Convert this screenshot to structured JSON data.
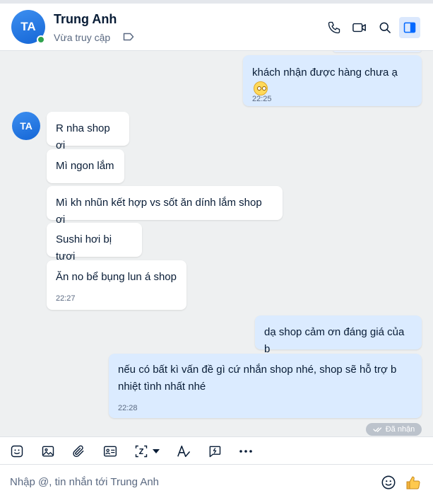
{
  "header": {
    "avatar_initials": "TA",
    "contact_name": "Trung Anh",
    "status": "Vừa truy cập",
    "icons": [
      "tag-icon",
      "phone-icon",
      "video-call-icon",
      "search-icon",
      "sidebar-toggle-icon"
    ]
  },
  "messages": [
    {
      "direction": "out",
      "text": "khách nhận được hàng chưa ạ",
      "emoji": "smiling-face-emoji",
      "time": "22:25"
    },
    {
      "direction": "in",
      "avatar_initials": "TA",
      "text": "R nha shop ơi"
    },
    {
      "direction": "in",
      "text": "Mì ngon lắm"
    },
    {
      "direction": "in",
      "text": "Mì kh nhũn kết hợp vs sốt ăn dính lắm shop ơi"
    },
    {
      "direction": "in",
      "text": "Sushi hơi bị tươi"
    },
    {
      "direction": "in",
      "text": "Ăn no bể bụng lun á shop",
      "time": "22:27"
    },
    {
      "direction": "out",
      "text": "dạ shop cảm ơn đáng giá của b"
    },
    {
      "direction": "out",
      "text": "nếu có bất kì vấn đề gì cứ nhắn shop nhé, shop sẽ hỗ trợ b nhiệt tình nhất nhé",
      "time": "22:28"
    }
  ],
  "delivery_status": "Đã nhận",
  "toolbar_icons": [
    "sticker-icon",
    "image-icon",
    "attachment-icon",
    "contact-card-icon",
    "screenshot-icon",
    "dropdown-caret-icon",
    "text-format-icon",
    "quick-message-icon",
    "more-options-icon"
  ],
  "composer": {
    "placeholder": "Nhập @, tin nhắn tới Trung Anh",
    "icons": [
      "emoji-icon",
      "thumbs-up-icon"
    ]
  },
  "colors": {
    "accent": "#0068ff",
    "avatar": "#1e74e8",
    "online": "#30a24d",
    "bubble_in": "#ffffff",
    "bubble_out": "#dbebff",
    "chat_bg": "#eef0f1"
  }
}
